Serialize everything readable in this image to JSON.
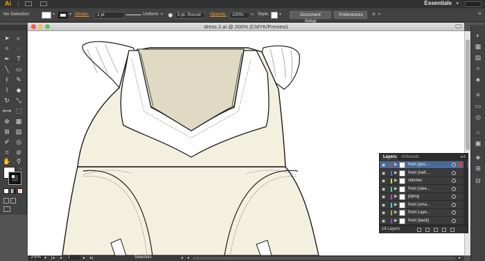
{
  "app": {
    "logo": "Ai",
    "workspace": "Essentials",
    "workspace_arrow": "▾"
  },
  "control_bar": {
    "selection_label": "No Selection",
    "stroke_label": "Stroke:",
    "stroke_weight": "1 pt",
    "profile": "Uniform",
    "brush": "5 pt. Round",
    "opacity_label": "Opacity:",
    "opacity_value": "100%",
    "style_label": "Style:",
    "document_setup": "Document Setup",
    "preferences": "Preferences"
  },
  "document": {
    "title": "dress 2.ai @ 200% (CMYK/Preview)",
    "fabric_color": "#f3f0df",
    "lining_color": "#e0dac4",
    "outline_color": "#1a1a1a"
  },
  "status_bar": {
    "zoom": "200%",
    "artboard": "1",
    "tool": "Selection"
  },
  "layers_panel": {
    "tabs": [
      "Layers",
      "Artboards"
    ],
    "active_tab": "Layers",
    "menu_icon": "▸≡",
    "count_label": "16 Layers",
    "rows": [
      {
        "name": "front (poc...",
        "color": "#e63a3a",
        "selected": true
      },
      {
        "name": "front (half...",
        "color": "#3a7ee6",
        "selected": false
      },
      {
        "name": "stitches",
        "color": "#e6d13a",
        "selected": false
      },
      {
        "name": "front (slee...",
        "color": "#3ae67e",
        "selected": false
      },
      {
        "name": "piping",
        "color": "#c83ae6",
        "selected": false
      },
      {
        "name": "front (sma...",
        "color": "#3ad9e6",
        "selected": false
      },
      {
        "name": "front Laye...",
        "color": "#e6923a",
        "selected": false
      },
      {
        "name": "front (back)",
        "color": "#9a3ae6",
        "selected": false
      }
    ]
  }
}
